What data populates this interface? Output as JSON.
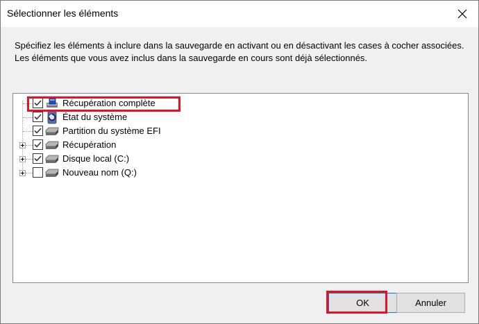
{
  "window": {
    "title": "Sélectionner les éléments",
    "close_glyph": "✕"
  },
  "description": "Spécifiez les éléments à inclure dans la sauvegarde en activant ou en désactivant les cases à cocher associées. Les éléments que vous avez inclus dans la sauvegarde en cours sont déjà sélectionnés.",
  "tree": {
    "items": [
      {
        "label": "Récupération complète",
        "checked": true,
        "icon": "full-recovery-icon",
        "highlighted": true
      },
      {
        "label": "État du système",
        "checked": true,
        "icon": "system-state-icon",
        "highlighted": false
      },
      {
        "label": "Partition du système EFI",
        "checked": true,
        "icon": "drive-icon",
        "highlighted": false
      },
      {
        "label": "Récupération",
        "checked": true,
        "icon": "drive-icon",
        "highlighted": false
      },
      {
        "label": "Disque local (C:)",
        "checked": true,
        "icon": "drive-icon",
        "highlighted": false
      },
      {
        "label": "Nouveau nom (Q:)",
        "checked": false,
        "icon": "drive-icon",
        "highlighted": false
      }
    ]
  },
  "buttons": {
    "ok": "OK",
    "cancel": "Annuler"
  },
  "colors": {
    "highlight": "#e81123",
    "accent": "#0078d7"
  }
}
